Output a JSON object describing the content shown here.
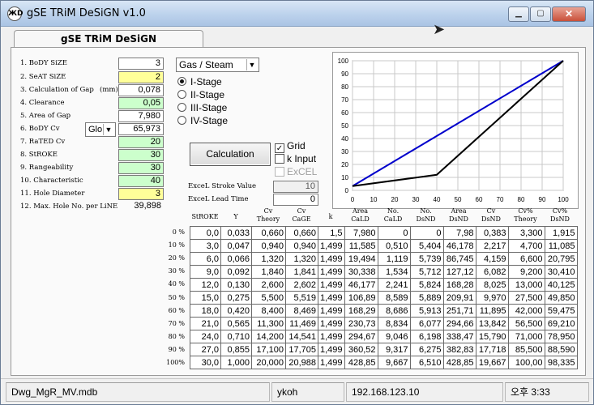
{
  "window": {
    "title": "gSE TRiM DeSiGN v1.0",
    "icon_text": "ЖD"
  },
  "tab": {
    "label": "gSE TRiM DeSiGN"
  },
  "inputs": [
    {
      "label": "1. BoDY SiZE",
      "value": "3",
      "style": "white"
    },
    {
      "label": "2. SeAT SiZE",
      "value": "2",
      "style": "yellow"
    },
    {
      "label": "3. Calculation of Gap",
      "unit": "(mm)",
      "value": "0,078",
      "style": "white"
    },
    {
      "label": "4. Clearance",
      "value": "0,05",
      "style": "green"
    },
    {
      "label": "5. Area of Gap",
      "value": "7,980",
      "style": "white"
    },
    {
      "label": "6. BoDY Cv",
      "select": "Glo",
      "value": "65,973",
      "style": "white"
    },
    {
      "label": "7. RaTED Cv",
      "value": "20",
      "style": "green"
    },
    {
      "label": "8. StROKE",
      "value": "30",
      "style": "green"
    },
    {
      "label": "9. Rangeability",
      "value": "30",
      "style": "green"
    },
    {
      "label": "10. Characteristic",
      "value": "40",
      "style": "green"
    },
    {
      "label": "11. Hole Diameter",
      "value": "3",
      "style": "yellow"
    },
    {
      "label": "12. Max. Hole No. per LiNE",
      "value": "39,898",
      "style": "plain"
    }
  ],
  "medium_select": "Gas / Steam",
  "stages": [
    {
      "label": "I-Stage",
      "selected": true
    },
    {
      "label": "II-Stage",
      "selected": false
    },
    {
      "label": "III-Stage",
      "selected": false
    },
    {
      "label": "IV-Stage",
      "selected": false
    }
  ],
  "calc_button": "Calculation",
  "checks": {
    "grid": "Grid",
    "grid_check": "✓",
    "k_input": "k Input",
    "excel": "ExCEL"
  },
  "excel_stroke": {
    "label": "ExceL Stroke Value",
    "value": "10"
  },
  "excel_lead": {
    "label": "ExceL Lead Time",
    "value": "0"
  },
  "chart_data": {
    "type": "line",
    "x_ticks": [
      "0",
      "10",
      "20",
      "30",
      "40",
      "50",
      "60",
      "70",
      "80",
      "90",
      "100"
    ],
    "y_ticks": [
      "0",
      "10",
      "20",
      "30",
      "40",
      "50",
      "60",
      "70",
      "80",
      "90",
      "100"
    ],
    "xlim": [
      0,
      100
    ],
    "ylim": [
      0,
      100
    ],
    "grid": true,
    "series": [
      {
        "color": "#0000cc",
        "x": [
          0,
          100
        ],
        "y": [
          3.3,
          100
        ]
      },
      {
        "color": "#000000",
        "x": [
          0,
          40,
          100
        ],
        "y": [
          3.3,
          12.0,
          100
        ]
      }
    ]
  },
  "table": {
    "headers": [
      "StROKE",
      "Y",
      "Cv\nTheory",
      "Cv\nCaGE",
      "k",
      "Area\nCaLD",
      "No.\nCaLD",
      "No.\nDsND",
      "Area\nDsND",
      "Cv\nDsND",
      "Cv%\nTheory",
      "Cv%\nDsND"
    ],
    "row_labels": [
      "0 %",
      "10 %",
      "20 %",
      "30 %",
      "40 %",
      "50 %",
      "60 %",
      "70 %",
      "80 %",
      "90 %",
      "100%"
    ],
    "rows": [
      [
        "0,0",
        "0,033",
        "0,660",
        "0,660",
        "1,5",
        "7,980",
        "0",
        "0",
        "7,98",
        "0,383",
        "3,300",
        "1,915"
      ],
      [
        "3,0",
        "0,047",
        "0,940",
        "0,940",
        "1,499",
        "11,585",
        "0,510",
        "5,404",
        "46,178",
        "2,217",
        "4,700",
        "11,085"
      ],
      [
        "6,0",
        "0,066",
        "1,320",
        "1,320",
        "1,499",
        "19,494",
        "1,119",
        "5,739",
        "86,745",
        "4,159",
        "6,600",
        "20,795"
      ],
      [
        "9,0",
        "0,092",
        "1,840",
        "1,841",
        "1,499",
        "30,338",
        "1,534",
        "5,712",
        "127,12",
        "6,082",
        "9,200",
        "30,410"
      ],
      [
        "12,0",
        "0,130",
        "2,600",
        "2,602",
        "1,499",
        "46,177",
        "2,241",
        "5,824",
        "168,28",
        "8,025",
        "13,000",
        "40,125"
      ],
      [
        "15,0",
        "0,275",
        "5,500",
        "5,519",
        "1,499",
        "106,89",
        "8,589",
        "5,889",
        "209,91",
        "9,970",
        "27,500",
        "49,850"
      ],
      [
        "18,0",
        "0,420",
        "8,400",
        "8,469",
        "1,499",
        "168,29",
        "8,686",
        "5,913",
        "251,71",
        "11,895",
        "42,000",
        "59,475"
      ],
      [
        "21,0",
        "0,565",
        "11,300",
        "11,469",
        "1,499",
        "230,73",
        "8,834",
        "6,077",
        "294,66",
        "13,842",
        "56,500",
        "69,210"
      ],
      [
        "24,0",
        "0,710",
        "14,200",
        "14,541",
        "1,499",
        "294,67",
        "9,046",
        "6,198",
        "338,47",
        "15,790",
        "71,000",
        "78,950"
      ],
      [
        "27,0",
        "0,855",
        "17,100",
        "17,705",
        "1,499",
        "360,52",
        "9,317",
        "6,275",
        "382,83",
        "17,718",
        "85,500",
        "88,590"
      ],
      [
        "30,0",
        "1,000",
        "20,000",
        "20,988",
        "1,499",
        "428,85",
        "9,667",
        "6,510",
        "428,85",
        "19,667",
        "100,00",
        "98,335"
      ]
    ]
  },
  "status": {
    "file": "Dwg_MgR_MV.mdb",
    "user": "ykoh",
    "ip": "192.168.123.10",
    "time": "오후 3:33"
  }
}
